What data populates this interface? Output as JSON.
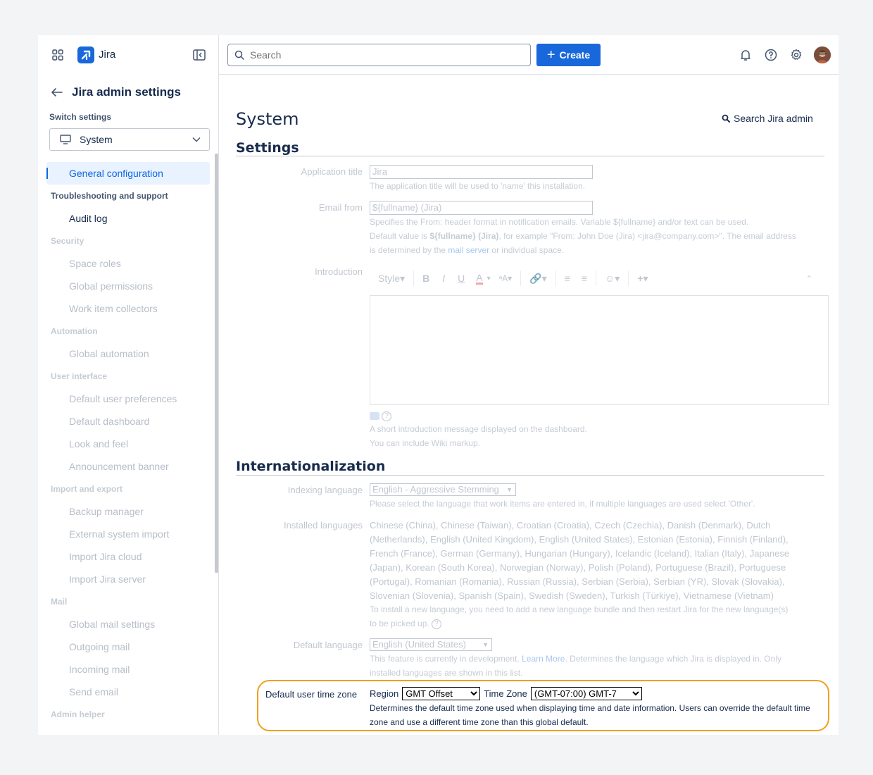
{
  "header": {
    "brand": "Jira",
    "search_placeholder": "Search",
    "create_label": "Create"
  },
  "sidebar": {
    "back_title": "Jira admin settings",
    "switch_label": "Switch settings",
    "switch_value": "System",
    "items": [
      {
        "type": "item",
        "label": "General configuration",
        "state": "active"
      },
      {
        "type": "section",
        "label": "Troubleshooting and support",
        "state": "normal"
      },
      {
        "type": "item",
        "label": "Audit log",
        "state": "normal"
      },
      {
        "type": "section",
        "label": "Security",
        "state": "dim"
      },
      {
        "type": "item",
        "label": "Space roles",
        "state": "dim"
      },
      {
        "type": "item",
        "label": "Global permissions",
        "state": "dim"
      },
      {
        "type": "item",
        "label": "Work item collectors",
        "state": "dim"
      },
      {
        "type": "section",
        "label": "Automation",
        "state": "dim"
      },
      {
        "type": "item",
        "label": "Global automation",
        "state": "dim"
      },
      {
        "type": "section",
        "label": "User interface",
        "state": "dim"
      },
      {
        "type": "item",
        "label": "Default user preferences",
        "state": "dim"
      },
      {
        "type": "item",
        "label": "Default dashboard",
        "state": "dim"
      },
      {
        "type": "item",
        "label": "Look and feel",
        "state": "dim"
      },
      {
        "type": "item",
        "label": "Announcement banner",
        "state": "dim"
      },
      {
        "type": "section",
        "label": "Import and export",
        "state": "dim"
      },
      {
        "type": "item",
        "label": "Backup manager",
        "state": "dim"
      },
      {
        "type": "item",
        "label": "External system import",
        "state": "dim"
      },
      {
        "type": "item",
        "label": "Import Jira cloud",
        "state": "dim"
      },
      {
        "type": "item",
        "label": "Import Jira server",
        "state": "dim"
      },
      {
        "type": "section",
        "label": "Mail",
        "state": "dim"
      },
      {
        "type": "item",
        "label": "Global mail settings",
        "state": "dim"
      },
      {
        "type": "item",
        "label": "Outgoing mail",
        "state": "dim"
      },
      {
        "type": "item",
        "label": "Incoming mail",
        "state": "dim"
      },
      {
        "type": "item",
        "label": "Send email",
        "state": "dim"
      },
      {
        "type": "section",
        "label": "Admin helper",
        "state": "dim"
      }
    ]
  },
  "main": {
    "page_title": "System",
    "admin_search": "Search Jira admin",
    "settings": {
      "title": "Settings",
      "app_title_label": "Application title",
      "app_title_value": "Jira",
      "app_title_desc": "The application title will be used to 'name' this installation.",
      "email_from_label": "Email from",
      "email_from_value": "${fullname} (Jira)",
      "email_desc_1": "Specifies the From: header format in notification emails. Variable ${fullname} and/or text can be used.",
      "email_desc_2a": "Default value is ",
      "email_desc_2b": "${fullname} (Jira)",
      "email_desc_2c": ", for example \"From: John Doe (Jira) <jira@company.com>\". The email address",
      "email_desc_3a": "is determined by the ",
      "email_desc_3b": "mail server",
      "email_desc_3c": " or individual space.",
      "intro_label": "Introduction",
      "toolbar_style": "Style",
      "intro_desc_1": "A short introduction message displayed on the dashboard.",
      "intro_desc_2": "You can include Wiki markup."
    },
    "i18n": {
      "title": "Internationalization",
      "indexing_label": "Indexing language",
      "indexing_value": "English - Aggressive Stemming",
      "indexing_desc": "Please select the language that work items are entered in, if multiple languages are used select 'Other'.",
      "installed_label": "Installed languages",
      "installed_lines": [
        "Chinese (China), Chinese (Taiwan), Croatian (Croatia), Czech (Czechia), Danish (Denmark), Dutch",
        "(Netherlands), English (United Kingdom), English (United States), Estonian (Estonia), Finnish (Finland),",
        "French (France), German (Germany), Hungarian (Hungary), Icelandic (Iceland), Italian (Italy), Japanese",
        "(Japan), Korean (South Korea), Norwegian (Norway), Polish (Poland), Portuguese (Brazil), Portuguese",
        "(Portugal), Romanian (Romania), Russian (Russia), Serbian (Serbia), Serbian (YR), Slovak (Slovakia),",
        "Slovenian (Slovenia), Spanish (Spain), Swedish (Sweden), Turkish (Türkiye), Vietnamese (Vietnam)"
      ],
      "installed_note_1": "To install a new language, you need to add a new language bundle and then restart Jira for the new language(s)",
      "installed_note_2": "to be picked up.",
      "default_lang_label": "Default language",
      "default_lang_value": "English (United States)",
      "default_lang_desc_1a": "This feature is currently in development. ",
      "default_lang_desc_1b": "Learn More",
      "default_lang_desc_1c": ". Determines the language which Jira is displayed in. Only",
      "default_lang_desc_2": "installed languages are shown in this list.",
      "tz_label": "Default user time zone",
      "region_label": "Region",
      "region_value": "GMT Offset",
      "tz_zone_label": "Time Zone",
      "tz_value": "(GMT-07:00) GMT-7",
      "tz_desc": "Determines the default time zone used when displaying time and date information. Users can override the default time zone and use a different time zone than this global default."
    }
  },
  "colors": {
    "brand_blue": "#1868db",
    "highlight": "#f0a020",
    "active_bg": "#e9f2ff"
  }
}
